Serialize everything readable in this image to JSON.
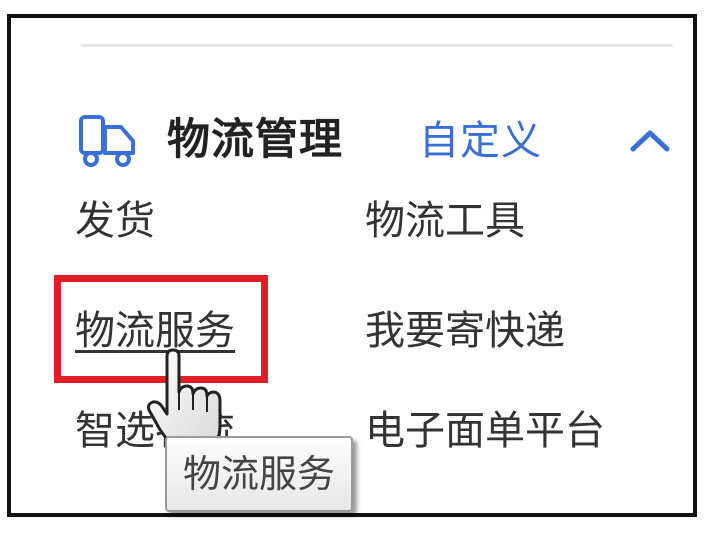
{
  "section": {
    "icon": "truck-icon",
    "title": "物流管理",
    "customize_label": "自定义",
    "toggle_icon": "chevron-up-icon"
  },
  "links": {
    "fahuo": "发货",
    "wuliu_gongju": "物流工具",
    "wuliu_fuwu": "物流服务",
    "woyao_jikuaidi": "我要寄快递",
    "zhixuan_wuliu": "智选物流",
    "dianzi_miandan": "电子面单平台"
  },
  "tooltip": {
    "text": "物流服务"
  },
  "colors": {
    "link_accent": "#3a6fd8",
    "highlight": "#e11d26"
  },
  "cursor": {
    "icon": "hand-pointer-icon"
  }
}
